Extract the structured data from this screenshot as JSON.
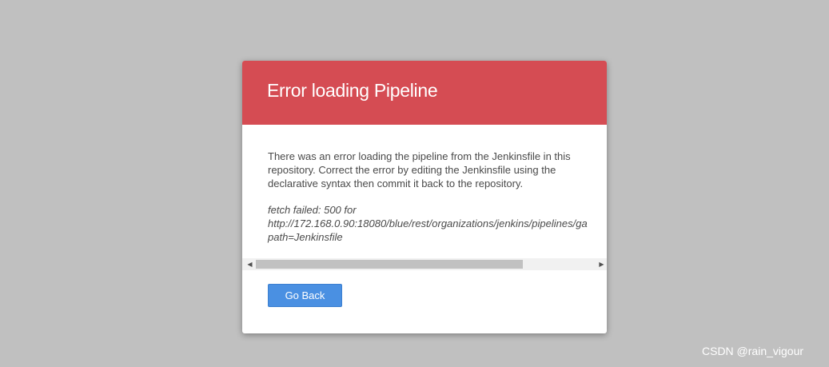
{
  "dialog": {
    "title": "Error loading Pipeline",
    "message": "There was an error loading the pipeline from the Jenkinsfile in this repository. Correct the error by editing the Jenkinsfile using the declarative syntax then commit it back to the repository.",
    "error_lines": [
      "fetch failed: 500 for",
      "http://172.168.0.90:18080/blue/rest/organizations/jenkins/pipelines/ga",
      "path=Jenkinsfile"
    ],
    "back_button_label": "Go Back"
  },
  "scrollbar": {
    "left_arrow": "◀",
    "right_arrow": "▶",
    "thumb_fraction": 0.77
  },
  "colors": {
    "header": "#d54c53",
    "button": "#4a90e2",
    "backdrop": "#c0c0c0"
  },
  "watermark": {
    "text": "CSDN @rain_vigour"
  }
}
